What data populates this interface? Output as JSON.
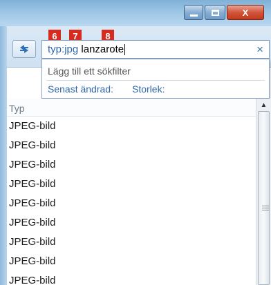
{
  "window": {
    "minimize_glyph": "",
    "close_glyph": "X"
  },
  "badges": [
    "6",
    "7",
    "8"
  ],
  "search": {
    "type_token": "typ:",
    "ext_token": "jpg",
    "query_text": "lanzarote",
    "clear_glyph": "×"
  },
  "dropdown": {
    "hint": "Lägg till ett sökfilter",
    "filters": [
      "Senast ändrad:",
      "Storlek:"
    ]
  },
  "list": {
    "column_header": "Typ",
    "rows": [
      "JPEG-bild",
      "JPEG-bild",
      "JPEG-bild",
      "JPEG-bild",
      "JPEG-bild",
      "JPEG-bild",
      "JPEG-bild",
      "JPEG-bild",
      "JPEG-bild"
    ]
  }
}
